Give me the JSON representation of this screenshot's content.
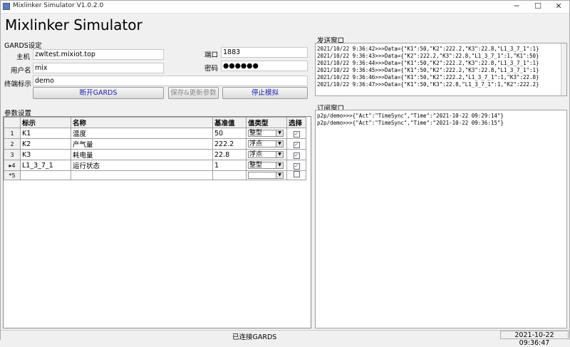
{
  "window": {
    "title": "Mixlinker Simulator V1.0.2.0"
  },
  "app_heading": "Mixlinker Simulator",
  "gards": {
    "group_label": "GARDS设定",
    "host_label": "主机",
    "host_value": "zwltest.mixiot.top",
    "port_label": "端口",
    "port_value": "1883",
    "user_label": "用户名",
    "user_value": "mix",
    "password_label": "密码",
    "password_value": "●●●●●●",
    "terminal_label": "终端标示",
    "terminal_value": "demo",
    "disconnect_label": "断开GARDS",
    "save_update_label": "保存&更新参数",
    "stop_sim_label": "停止模拟"
  },
  "params": {
    "group_label": "参数设置",
    "columns": [
      "标示",
      "名称",
      "基准值",
      "值类型",
      "选择"
    ],
    "rows": [
      {
        "num": "1",
        "id": "K1",
        "name": "温度",
        "base": "50",
        "type": "整型",
        "checked": "✓"
      },
      {
        "num": "2",
        "id": "K2",
        "name": "产气量",
        "base": "222.2",
        "type": "浮点",
        "checked": "✓"
      },
      {
        "num": "3",
        "id": "K3",
        "name": "耗电量",
        "base": "22.8",
        "type": "浮点",
        "checked": "✓"
      },
      {
        "num": "▸4",
        "id": "L1_3_7_1",
        "name": "运行状态",
        "base": "1",
        "type": "整型",
        "checked": "✓"
      },
      {
        "num": "*5",
        "id": "",
        "name": "",
        "base": "",
        "type": "",
        "checked": ""
      }
    ]
  },
  "send_window": {
    "label": "发送窗口",
    "lines": [
      "2021/10/22 9:36:42>>>Data={\"K1\":50,\"K2\":222.2,\"K3\":22.8,\"L1_3_7_1\":1}",
      "2021/10/22 9:36:43>>>Data={\"K2\":222.2,\"K3\":22.8,\"L1_3_7_1\":1,\"K1\":50}",
      "2021/10/22 9:36:44>>>Data={\"K1\":50,\"K2\":222.2,\"K3\":22.8,\"L1_3_7_1\":1}",
      "2021/10/22 9:36:45>>>Data={\"K1\":50,\"K2\":222.2,\"K3\":22.8,\"L1_3_7_1\":1}",
      "2021/10/22 9:36:46>>>Data={\"K1\":50,\"K2\":222.2,\"L1_3_7_1\":1,\"K3\":22.8}",
      "2021/10/22 9:36:47>>>Data={\"K1\":50,\"K3\":22.8,\"L1_3_7_1\":1,\"K2\":222.2}"
    ]
  },
  "sub_window": {
    "label": "订阅窗口",
    "lines": [
      "p2p/demo>>>{\"Act\":\"TimeSync\",\"Time\":\"2021-10-22 09:29:14\"}",
      "p2p/demo>>>{\"Act\":\"TimeSync\",\"Time\":\"2021-10-22 09:36:15\"}"
    ]
  },
  "status": {
    "connection": "已连接GARDS",
    "datetime": "2021-10-22 09:36:47"
  }
}
